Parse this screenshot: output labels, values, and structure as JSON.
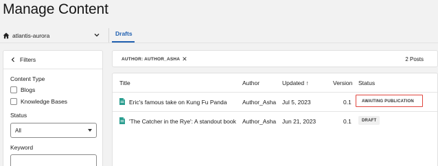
{
  "page": {
    "title": "Manage Content"
  },
  "site_selector": {
    "name": "atlantis-aurora",
    "icon": "home-icon"
  },
  "tabs": [
    {
      "label": "Drafts",
      "active": true
    }
  ],
  "filters": {
    "header": "Filters",
    "content_type_label": "Content Type",
    "content_types": [
      {
        "label": "Blogs",
        "checked": false
      },
      {
        "label": "Knowledge Bases",
        "checked": false
      }
    ],
    "status_label": "Status",
    "status_value": "All",
    "keyword_label": "Keyword",
    "keyword_value": ""
  },
  "filter_bar": {
    "chip_label": "AUTHOR: AUTHOR_ASHA",
    "post_count": "2 Posts"
  },
  "table": {
    "headers": {
      "title": "Title",
      "author": "Author",
      "updated": "Updated",
      "version": "Version",
      "status": "Status"
    },
    "rows": [
      {
        "title": "Eric's famous take on Kung Fu Panda",
        "author": "Author_Asha",
        "updated": "Jul 5, 2023",
        "version": "0.1",
        "status": "AWAITING PUBLICATION"
      },
      {
        "title": "'The Catcher in the Rye': A standout book",
        "author": "Author_Asha",
        "updated": "Jun 21, 2023",
        "version": "0.1",
        "status": "DRAFT"
      }
    ]
  },
  "colors": {
    "accent": "#1f5fb0",
    "doc_icon": "#2a9d8f",
    "highlight": "#e0443c"
  }
}
